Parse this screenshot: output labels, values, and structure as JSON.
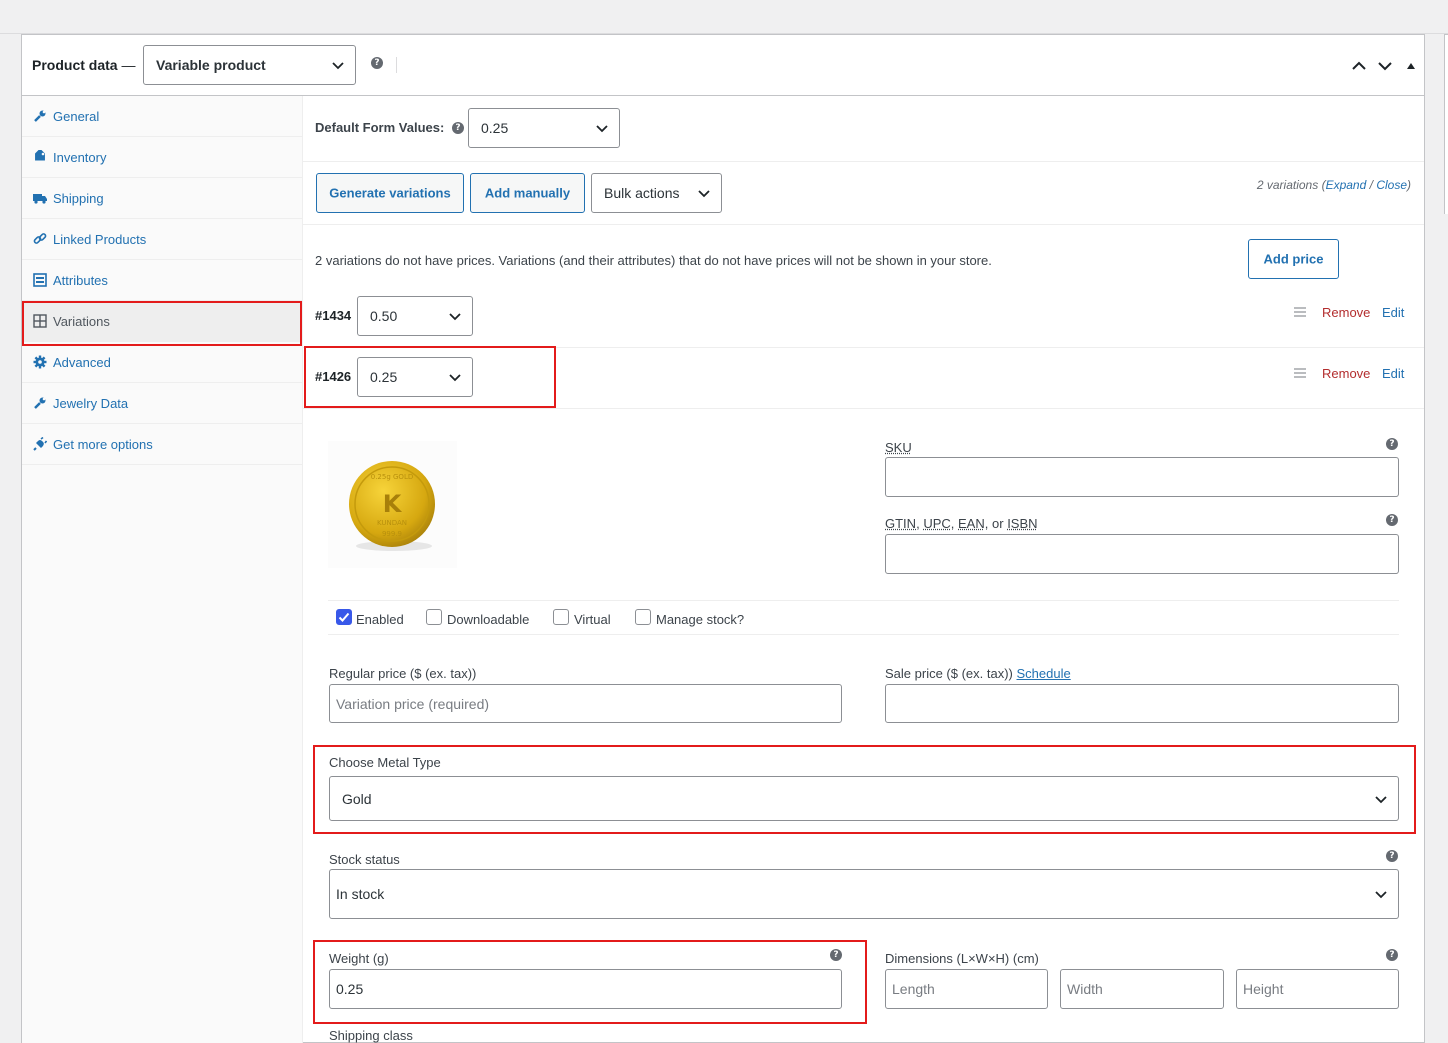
{
  "header": {
    "title": "Product data",
    "dash": "—",
    "product_type": "Variable product"
  },
  "tabs": [
    {
      "label": "General",
      "icon": "wrench-icon"
    },
    {
      "label": "Inventory",
      "icon": "tag-icon"
    },
    {
      "label": "Shipping",
      "icon": "truck-icon"
    },
    {
      "label": "Linked Products",
      "icon": "link-icon"
    },
    {
      "label": "Attributes",
      "icon": "list-icon"
    },
    {
      "label": "Variations",
      "icon": "grid-icon",
      "active": true
    },
    {
      "label": "Advanced",
      "icon": "gear-icon"
    },
    {
      "label": "Jewelry Data",
      "icon": "wrench-icon"
    },
    {
      "label": "Get more options",
      "icon": "plugin-icon"
    }
  ],
  "defaults": {
    "label": "Default Form Values:",
    "value": "0.25"
  },
  "toolbar": {
    "generate_label": "Generate variations",
    "add_manually_label": "Add manually",
    "bulk_actions_label": "Bulk actions",
    "count_text": "2 variations",
    "expand_label": "Expand",
    "slash": "/",
    "close_label": "Close",
    "open_paren": "(",
    "close_paren": ")"
  },
  "notice": {
    "text": "2 variations do not have prices. Variations (and their attributes) that do not have prices will not be shown in your store.",
    "add_price_label": "Add price"
  },
  "variations": [
    {
      "id": "#1434",
      "value": "0.50",
      "remove": "Remove",
      "edit": "Edit"
    },
    {
      "id": "#1426",
      "value": "0.25",
      "remove": "Remove",
      "edit": "Edit"
    }
  ],
  "coin": {
    "top_text": "0.25g GOLD",
    "letter": "K",
    "brand": "KUNDAN",
    "purity": "999.9"
  },
  "fields": {
    "sku_label": "SKU",
    "gtin_label_1": "GTIN",
    "gtin_label_2": "UPC",
    "gtin_label_3": "EAN",
    "gtin_label_4": "ISBN",
    "comma": ",",
    "or": "or",
    "enabled_label": "Enabled",
    "downloadable_label": "Downloadable",
    "virtual_label": "Virtual",
    "manage_stock_label": "Manage stock?",
    "regular_price_label": "Regular price ($ (ex. tax))",
    "regular_price_placeholder": "Variation price (required)",
    "sale_price_label": "Sale price ($ (ex. tax))",
    "schedule_label": "Schedule",
    "metal_type_label": "Choose Metal Type",
    "metal_type_value": "Gold",
    "stock_status_label": "Stock status",
    "stock_status_value": "In stock",
    "weight_label": "Weight (g)",
    "weight_value": "0.25",
    "dimensions_label": "Dimensions (L×W×H) (cm)",
    "length_placeholder": "Length",
    "width_placeholder": "Width",
    "height_placeholder": "Height",
    "shipping_class_label": "Shipping class"
  },
  "colors": {
    "link": "#2271b1",
    "remove": "#b32d2e",
    "highlight": "#e31b1b",
    "checkbox": "#3858e9"
  }
}
